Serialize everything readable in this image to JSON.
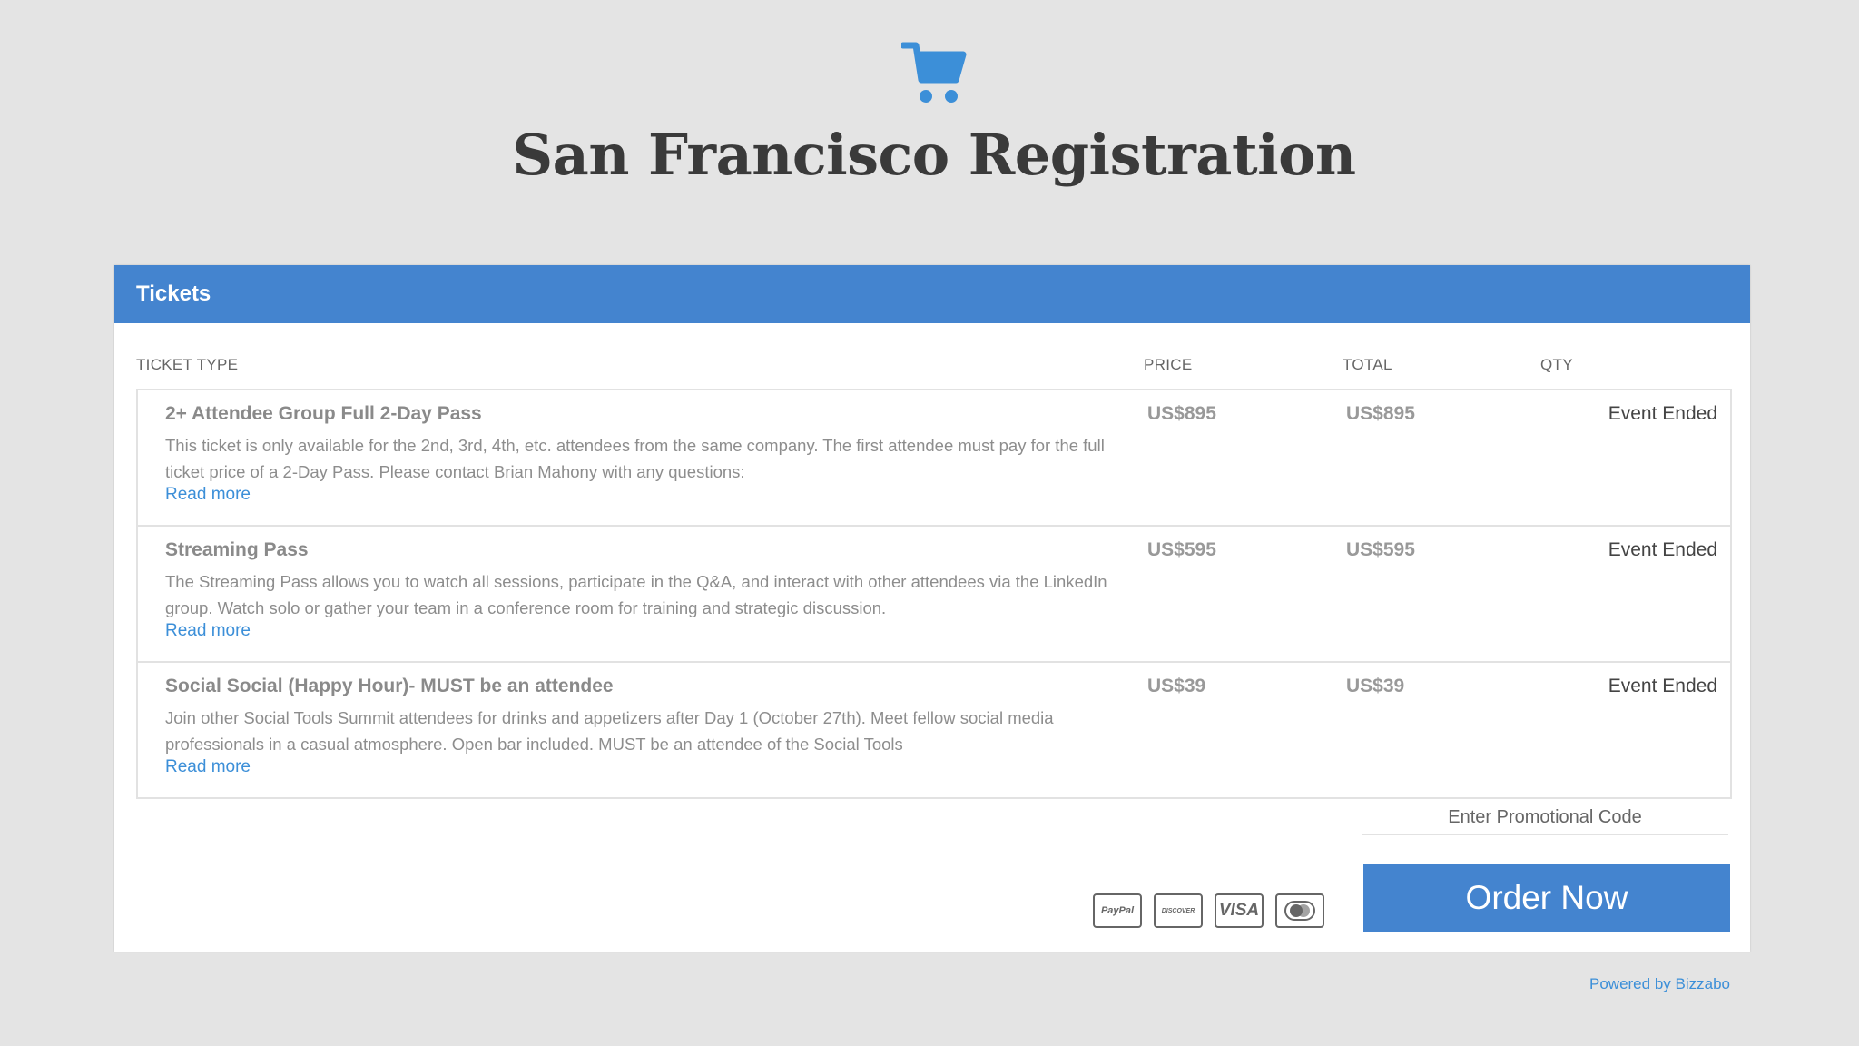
{
  "page": {
    "title": "San Francisco Registration",
    "accent_color": "#4484cf",
    "link_color": "#3c8fd8",
    "icon": "shopping-cart-icon"
  },
  "panel": {
    "header": "Tickets",
    "columns": {
      "ticket_type": "TICKET TYPE",
      "price": "PRICE",
      "total": "TOTAL",
      "qty": "QTY"
    },
    "tickets": [
      {
        "name": "2+ Attendee Group Full 2-Day Pass",
        "description": "This ticket is only available for the 2nd, 3rd, 4th, etc. attendees from the same company. The first attendee must pay for the full ticket price of a 2-Day Pass. Please contact Brian Mahony with any questions:",
        "read_more": "Read more",
        "price": "US$895",
        "total": "US$895",
        "status": "Event Ended"
      },
      {
        "name": "Streaming Pass",
        "description": "The Streaming Pass allows you to watch all sessions, participate in the Q&A, and interact with other attendees via the LinkedIn group. Watch solo or gather your team in a conference room for training and strategic discussion.",
        "read_more": "Read more",
        "price": "US$595",
        "total": "US$595",
        "status": "Event Ended"
      },
      {
        "name": "Social Social (Happy Hour)- MUST be an attendee",
        "description": "Join other Social Tools Summit attendees for drinks and appetizers after Day 1 (October 27th). Meet fellow social media professionals in a casual atmosphere. Open bar included. MUST be an attendee of the Social Tools",
        "read_more": "Read more",
        "price": "US$39",
        "total": "US$39",
        "status": "Event Ended"
      }
    ],
    "promo_placeholder": "Enter Promotional Code",
    "order_button": "Order Now",
    "payment_methods": [
      {
        "name": "paypal-icon",
        "label": "PayPal"
      },
      {
        "name": "discover-icon",
        "label": "DISCOVER"
      },
      {
        "name": "visa-icon",
        "label": "VISA"
      },
      {
        "name": "mastercard-icon",
        "label": ""
      }
    ]
  },
  "footer": {
    "powered_by": "Powered by",
    "brand": "Bizzabo"
  }
}
